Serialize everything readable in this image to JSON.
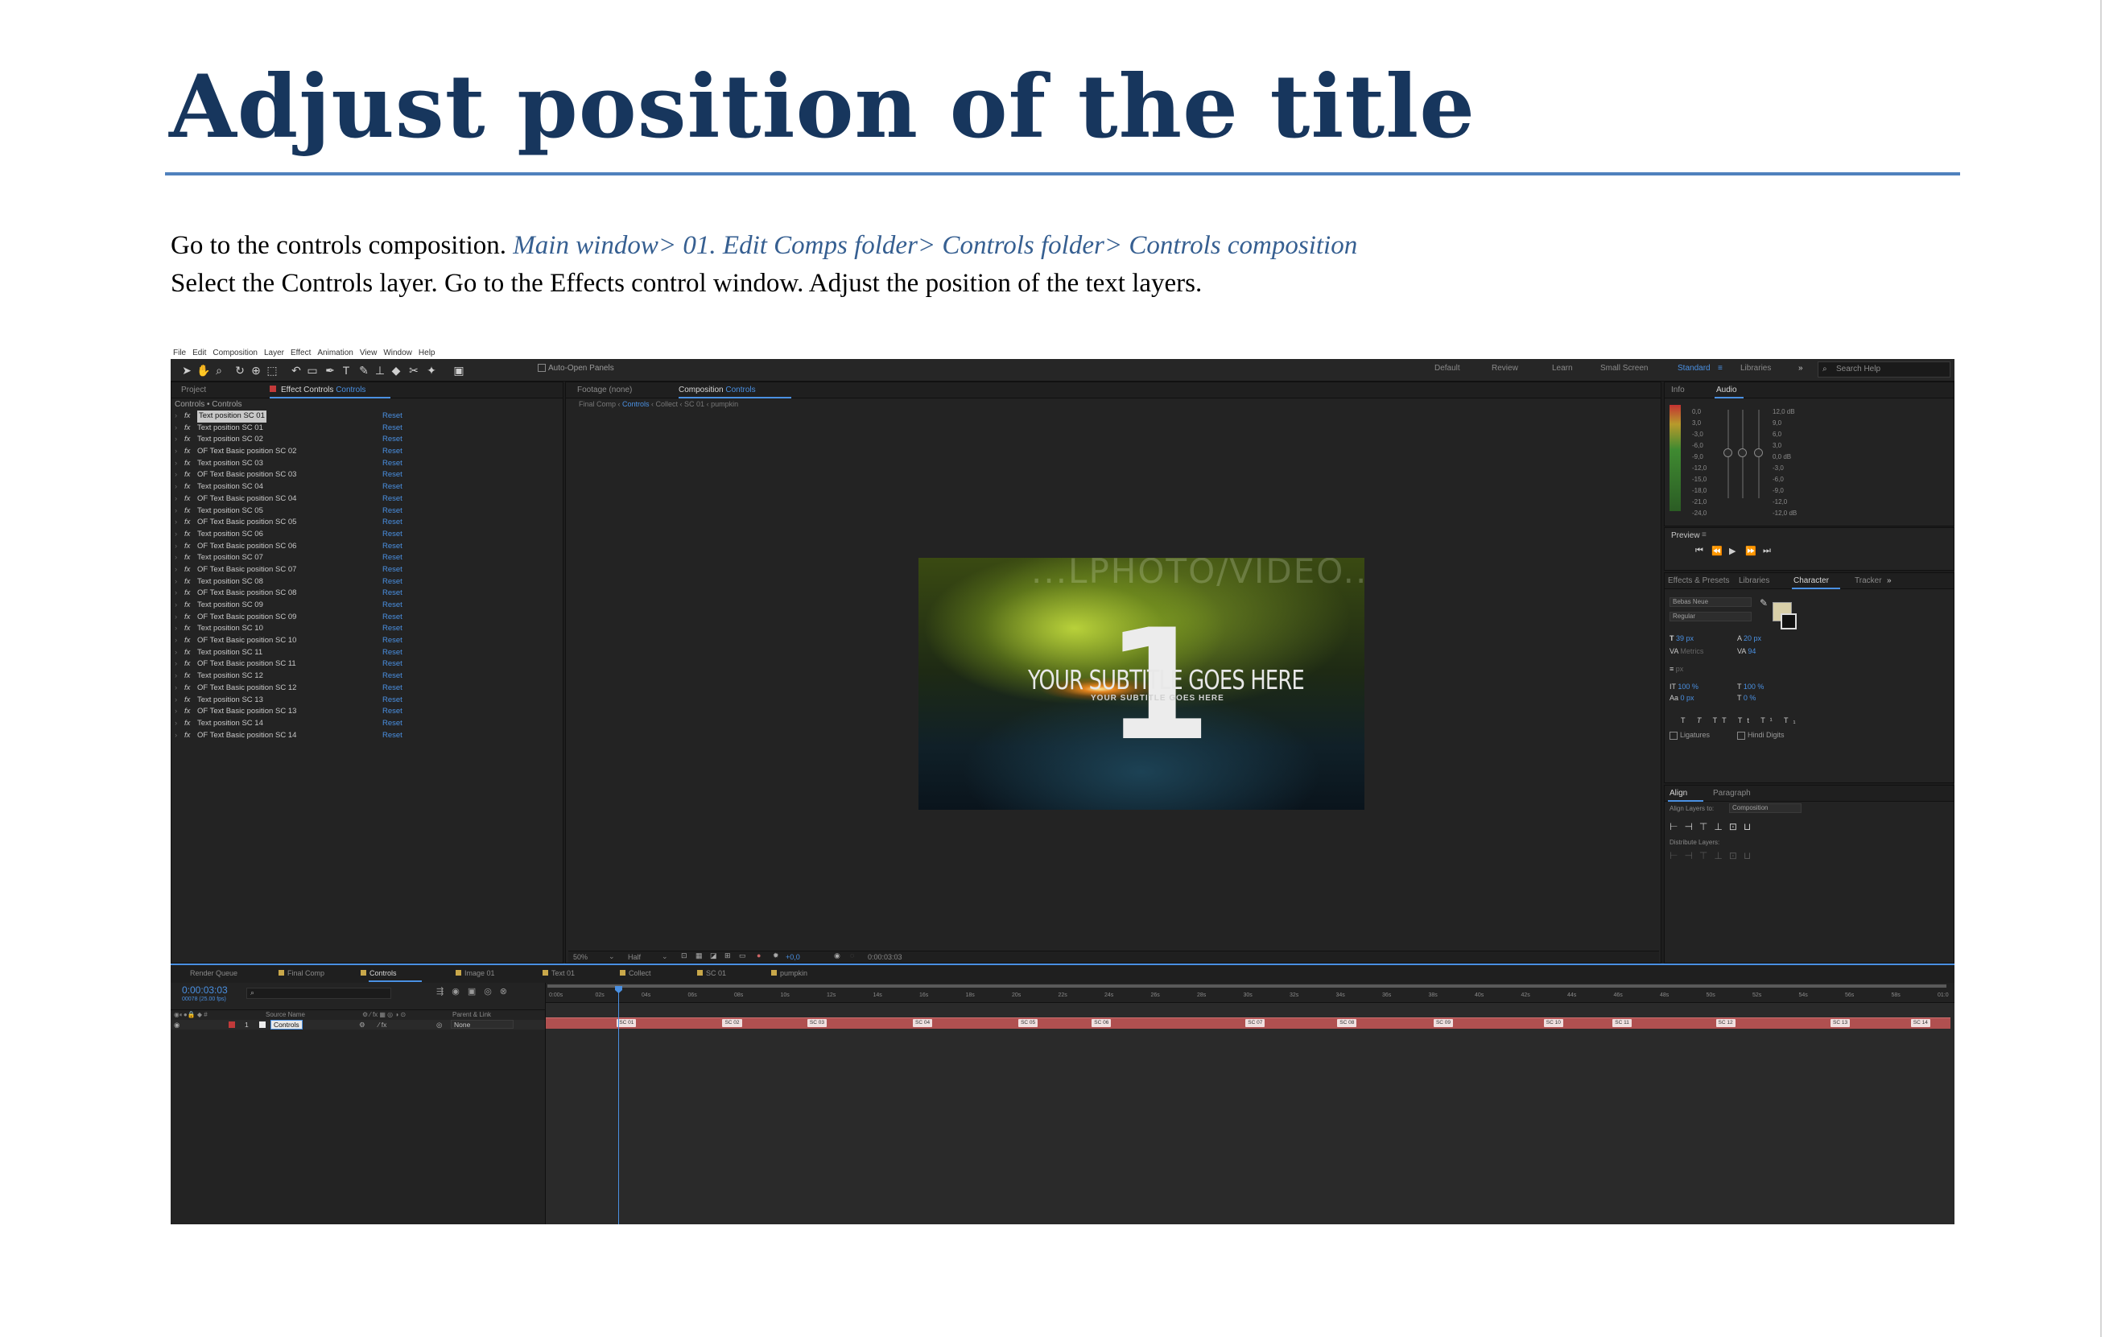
{
  "document": {
    "title": "Adjust position of the title",
    "para1_plain": "Go to the controls composition. ",
    "para1_path": "Main window> 01. Edit Comps folder> Controls folder> Controls composition",
    "para2": "Select the Controls layer. Go to the Effects control window. Adjust the position of the text layers."
  },
  "app": {
    "menu": [
      "File",
      "Edit",
      "Composition",
      "Layer",
      "Effect",
      "Animation",
      "View",
      "Window",
      "Help"
    ],
    "auto_open_panels": "Auto-Open Panels",
    "workspaces": [
      "Default",
      "Review",
      "Learn",
      "Small Screen",
      "Standard",
      "Libraries"
    ],
    "active_workspace": "Standard",
    "search_placeholder": "Search Help",
    "left_panel": {
      "tab_project": "Project",
      "tab_effect_prefix": "Effect Controls ",
      "tab_effect_layer": "Controls",
      "breadcrumb": "Controls • Controls",
      "reset_label": "Reset",
      "effects": [
        "Text position SC 01",
        "Text position SC 01",
        "Text position SC 02",
        "OF Text Basic position SC 02",
        "Text position SC 03",
        "OF Text Basic position SC 03",
        "Text position SC 04",
        "OF Text Basic position SC 04",
        "Text position SC 05",
        "OF Text Basic position SC 05",
        "Text position SC 06",
        "OF Text Basic position SC 06",
        "Text position SC 07",
        "OF Text Basic position SC 07",
        "Text position SC 08",
        "OF Text Basic position SC 08",
        "Text position SC 09",
        "OF Text Basic position SC 09",
        "Text position SC 10",
        "OF Text Basic position SC 10",
        "Text position SC 11",
        "OF Text Basic position SC 11",
        "Text position SC 12",
        "OF Text Basic position SC 12",
        "Text position SC 13",
        "OF Text Basic position SC 13",
        "Text position SC 14",
        "OF Text Basic position SC 14"
      ]
    },
    "comp_panel": {
      "tab_footage": "Footage (none)",
      "tab_comp_prefix": "Composition ",
      "tab_comp_name": "Controls",
      "crumbs": [
        "Final Comp",
        "Controls",
        "Collect",
        "SC 01",
        "pumpkin"
      ],
      "frame_top_text": "...LPHOTO/VIDEO...",
      "frame_number": "1",
      "frame_subtitle": "YOUR SUBTITLE GOES HERE",
      "frame_subtitle_small": "YOUR SUBTITLE GOES HERE",
      "zoom": "50%",
      "resolution": "Half",
      "exposure": "+0,0",
      "timecode": "0:00:03:03"
    },
    "info_tabs": [
      "Info",
      "Audio"
    ],
    "audio_levels_left": [
      "0,0",
      "3,0",
      "-3,0",
      "-6,0",
      "-9,0",
      "-12,0",
      "-15,0",
      "-18,0",
      "-21,0",
      "-24,0"
    ],
    "audio_levels_right": [
      "12,0 dB",
      "9,0",
      "6,0",
      "3,0",
      "0,0 dB",
      "-3,0",
      "-6,0",
      "-9,0",
      "-12,0",
      "-12,0 dB"
    ],
    "preview_label": "Preview",
    "char_tabs": [
      "Effects & Presets",
      "Libraries",
      "Character",
      "Tracker"
    ],
    "char": {
      "font": "Bebas Neue",
      "style": "Regular",
      "size": "39 px",
      "leading": "20 px",
      "kerning": "Metrics",
      "tracking": "94",
      "stroke_unit": "px",
      "vscale": "100 %",
      "hscale": "100 %",
      "baseline": "0 px",
      "tsume": "0 %",
      "ligatures": "Ligatures",
      "hindi": "Hindi Digits"
    },
    "align_tabs": [
      "Align",
      "Paragraph"
    ],
    "align_to_label": "Align Layers to:",
    "align_to_value": "Composition",
    "distribute_label": "Distribute Layers:",
    "timeline": {
      "tabs": [
        "Render Queue",
        "Final Comp",
        "Controls",
        "Image 01",
        "Text 01",
        "Collect",
        "SC 01",
        "pumpkin"
      ],
      "active_tab": "Controls",
      "timecode": "0:00:03:03",
      "frame_info": "00078 (25.00 fps)",
      "col_source": "Source Name",
      "col_parent": "Parent & Link",
      "layer_num": "1",
      "layer_name": "Controls",
      "parent_value": "None",
      "ruler": [
        "0:00s",
        "02s",
        "04s",
        "06s",
        "08s",
        "10s",
        "12s",
        "14s",
        "16s",
        "18s",
        "20s",
        "22s",
        "24s",
        "26s",
        "28s",
        "30s",
        "32s",
        "34s",
        "36s",
        "38s",
        "40s",
        "42s",
        "44s",
        "46s",
        "48s",
        "50s",
        "52s",
        "54s",
        "56s",
        "58s",
        "01:0"
      ],
      "markers": [
        "SC 01",
        "SC 02",
        "SC 03",
        "SC 04",
        "SC 05",
        "SC 06",
        "SC 07",
        "SC 08",
        "SC 09",
        "SC 10",
        "SC 11",
        "SC 12",
        "SC 13",
        "SC 14"
      ]
    },
    "colors": {
      "accent_blue": "#4a90e2",
      "layer_bar": "#b05050",
      "title_blue": "#17365d",
      "rule_blue": "#4f81bd"
    }
  }
}
